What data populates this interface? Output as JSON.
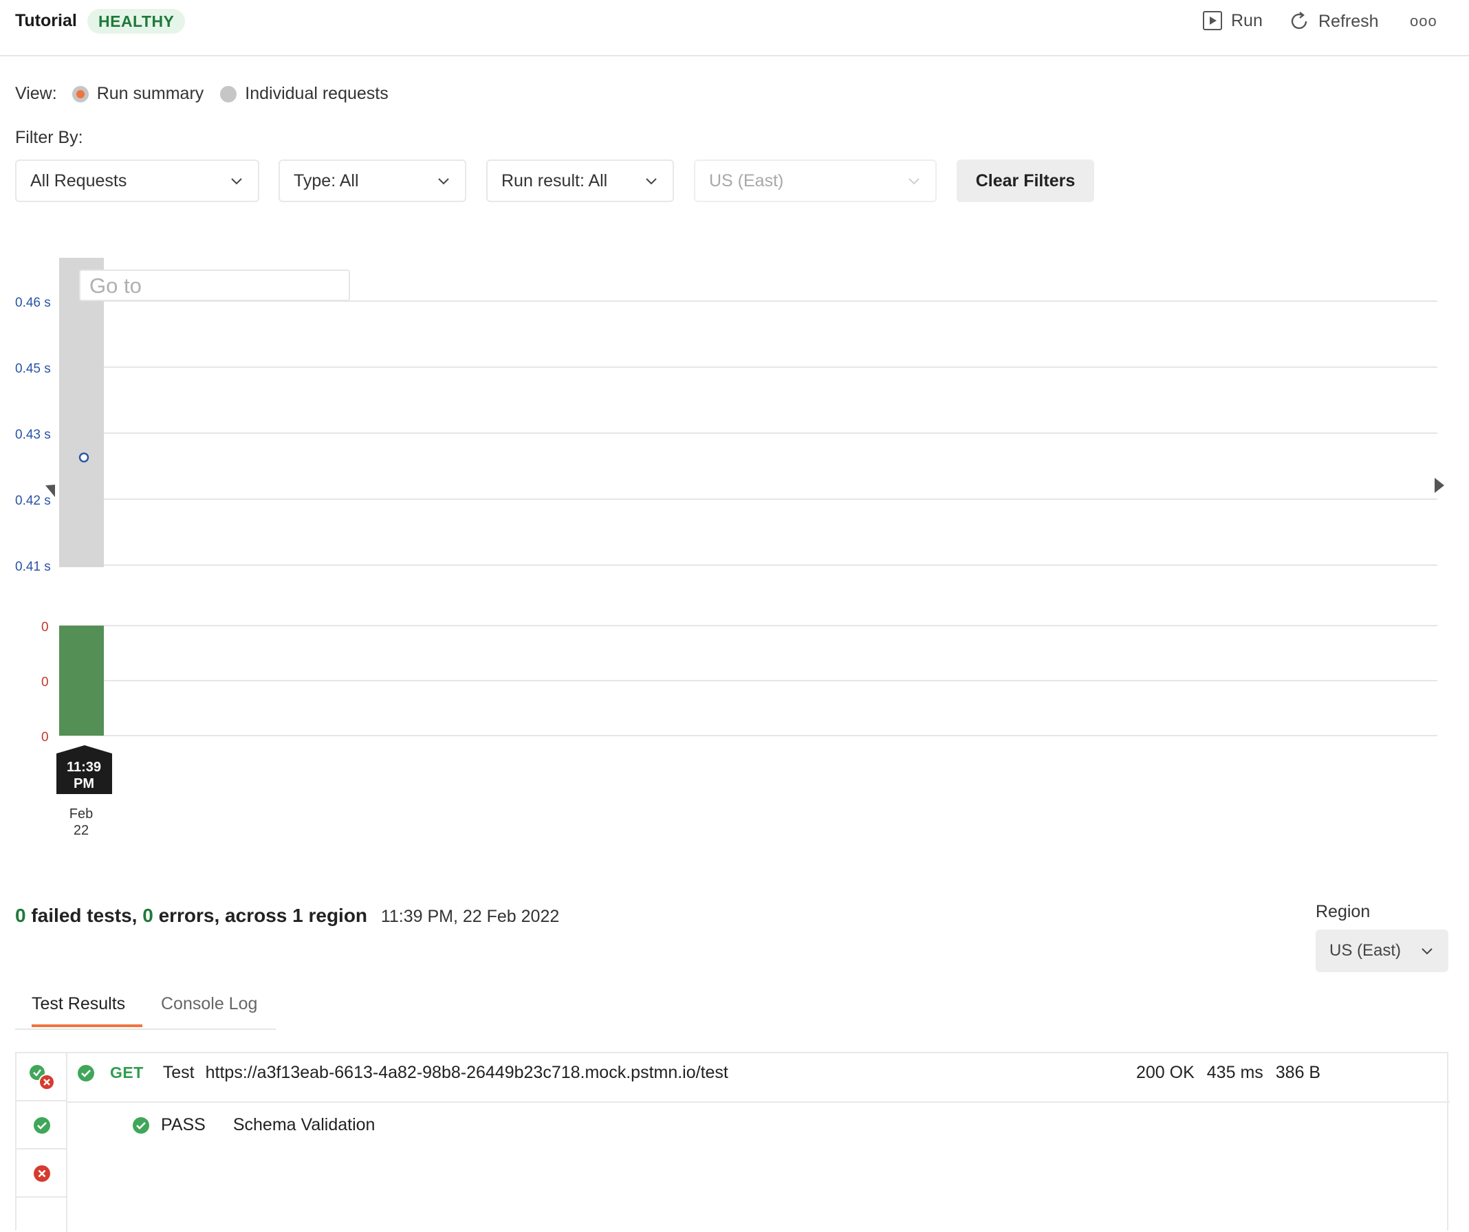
{
  "header": {
    "title": "Tutorial",
    "status_badge": "HEALTHY",
    "run_label": "Run",
    "refresh_label": "Refresh",
    "more_label": "ooo"
  },
  "view": {
    "label": "View:",
    "options": [
      "Run summary",
      "Individual requests"
    ],
    "selected": "Run summary"
  },
  "filters": {
    "label": "Filter By:",
    "requests": "All Requests",
    "type": "Type: All",
    "run_result": "Run result: All",
    "region": "US (East)",
    "clear_label": "Clear Filters"
  },
  "chart": {
    "goto_placeholder": "Go to",
    "tooltip_time": [
      "11:39",
      "PM"
    ],
    "date_label": [
      "Feb",
      "22"
    ]
  },
  "chart_data": {
    "type": "line",
    "response_time": {
      "y_tick_labels": [
        "0.46 s",
        "0.45 s",
        "0.43 s",
        "0.42 s",
        "0.41 s"
      ],
      "y_ticks": [
        0.46,
        0.45,
        0.43,
        0.42,
        0.41
      ],
      "points": [
        {
          "x": "11:39 PM, Feb 22",
          "y": 0.43
        }
      ]
    },
    "failures": {
      "type": "bar",
      "y_tick_labels": [
        "0",
        "0",
        "0"
      ],
      "bars": [
        {
          "x": "11:39 PM, Feb 22",
          "value": 0
        }
      ]
    },
    "colors": {
      "bar": "#548f55",
      "point": "#2953a6",
      "ticks_time": "#2953a6",
      "ticks_fail": "#c0392b"
    }
  },
  "summary": {
    "failed_count": "0",
    "failed_text": "failed tests,",
    "error_count": "0",
    "error_text": "errors, across 1 region",
    "timestamp": "11:39 PM, 22 Feb 2022",
    "region_label": "Region",
    "region_value": "US (East)"
  },
  "tabs": {
    "test_results": "Test Results",
    "console_log": "Console Log"
  },
  "results": {
    "request": {
      "method": "GET",
      "name": "Test",
      "url": "https://a3f13eab-6613-4a82-98b8-26449b23c718.mock.pstmn.io/test",
      "status": "200 OK",
      "time": "435 ms",
      "size": "386 B"
    },
    "tests": [
      {
        "status": "PASS",
        "name": "Schema Validation"
      }
    ]
  },
  "colors": {
    "accent": "#f0743f",
    "success": "#3fa65a",
    "error": "#d63b2f",
    "healthy_bg": "#e6f5e9",
    "healthy_text": "#1f7a3a"
  }
}
